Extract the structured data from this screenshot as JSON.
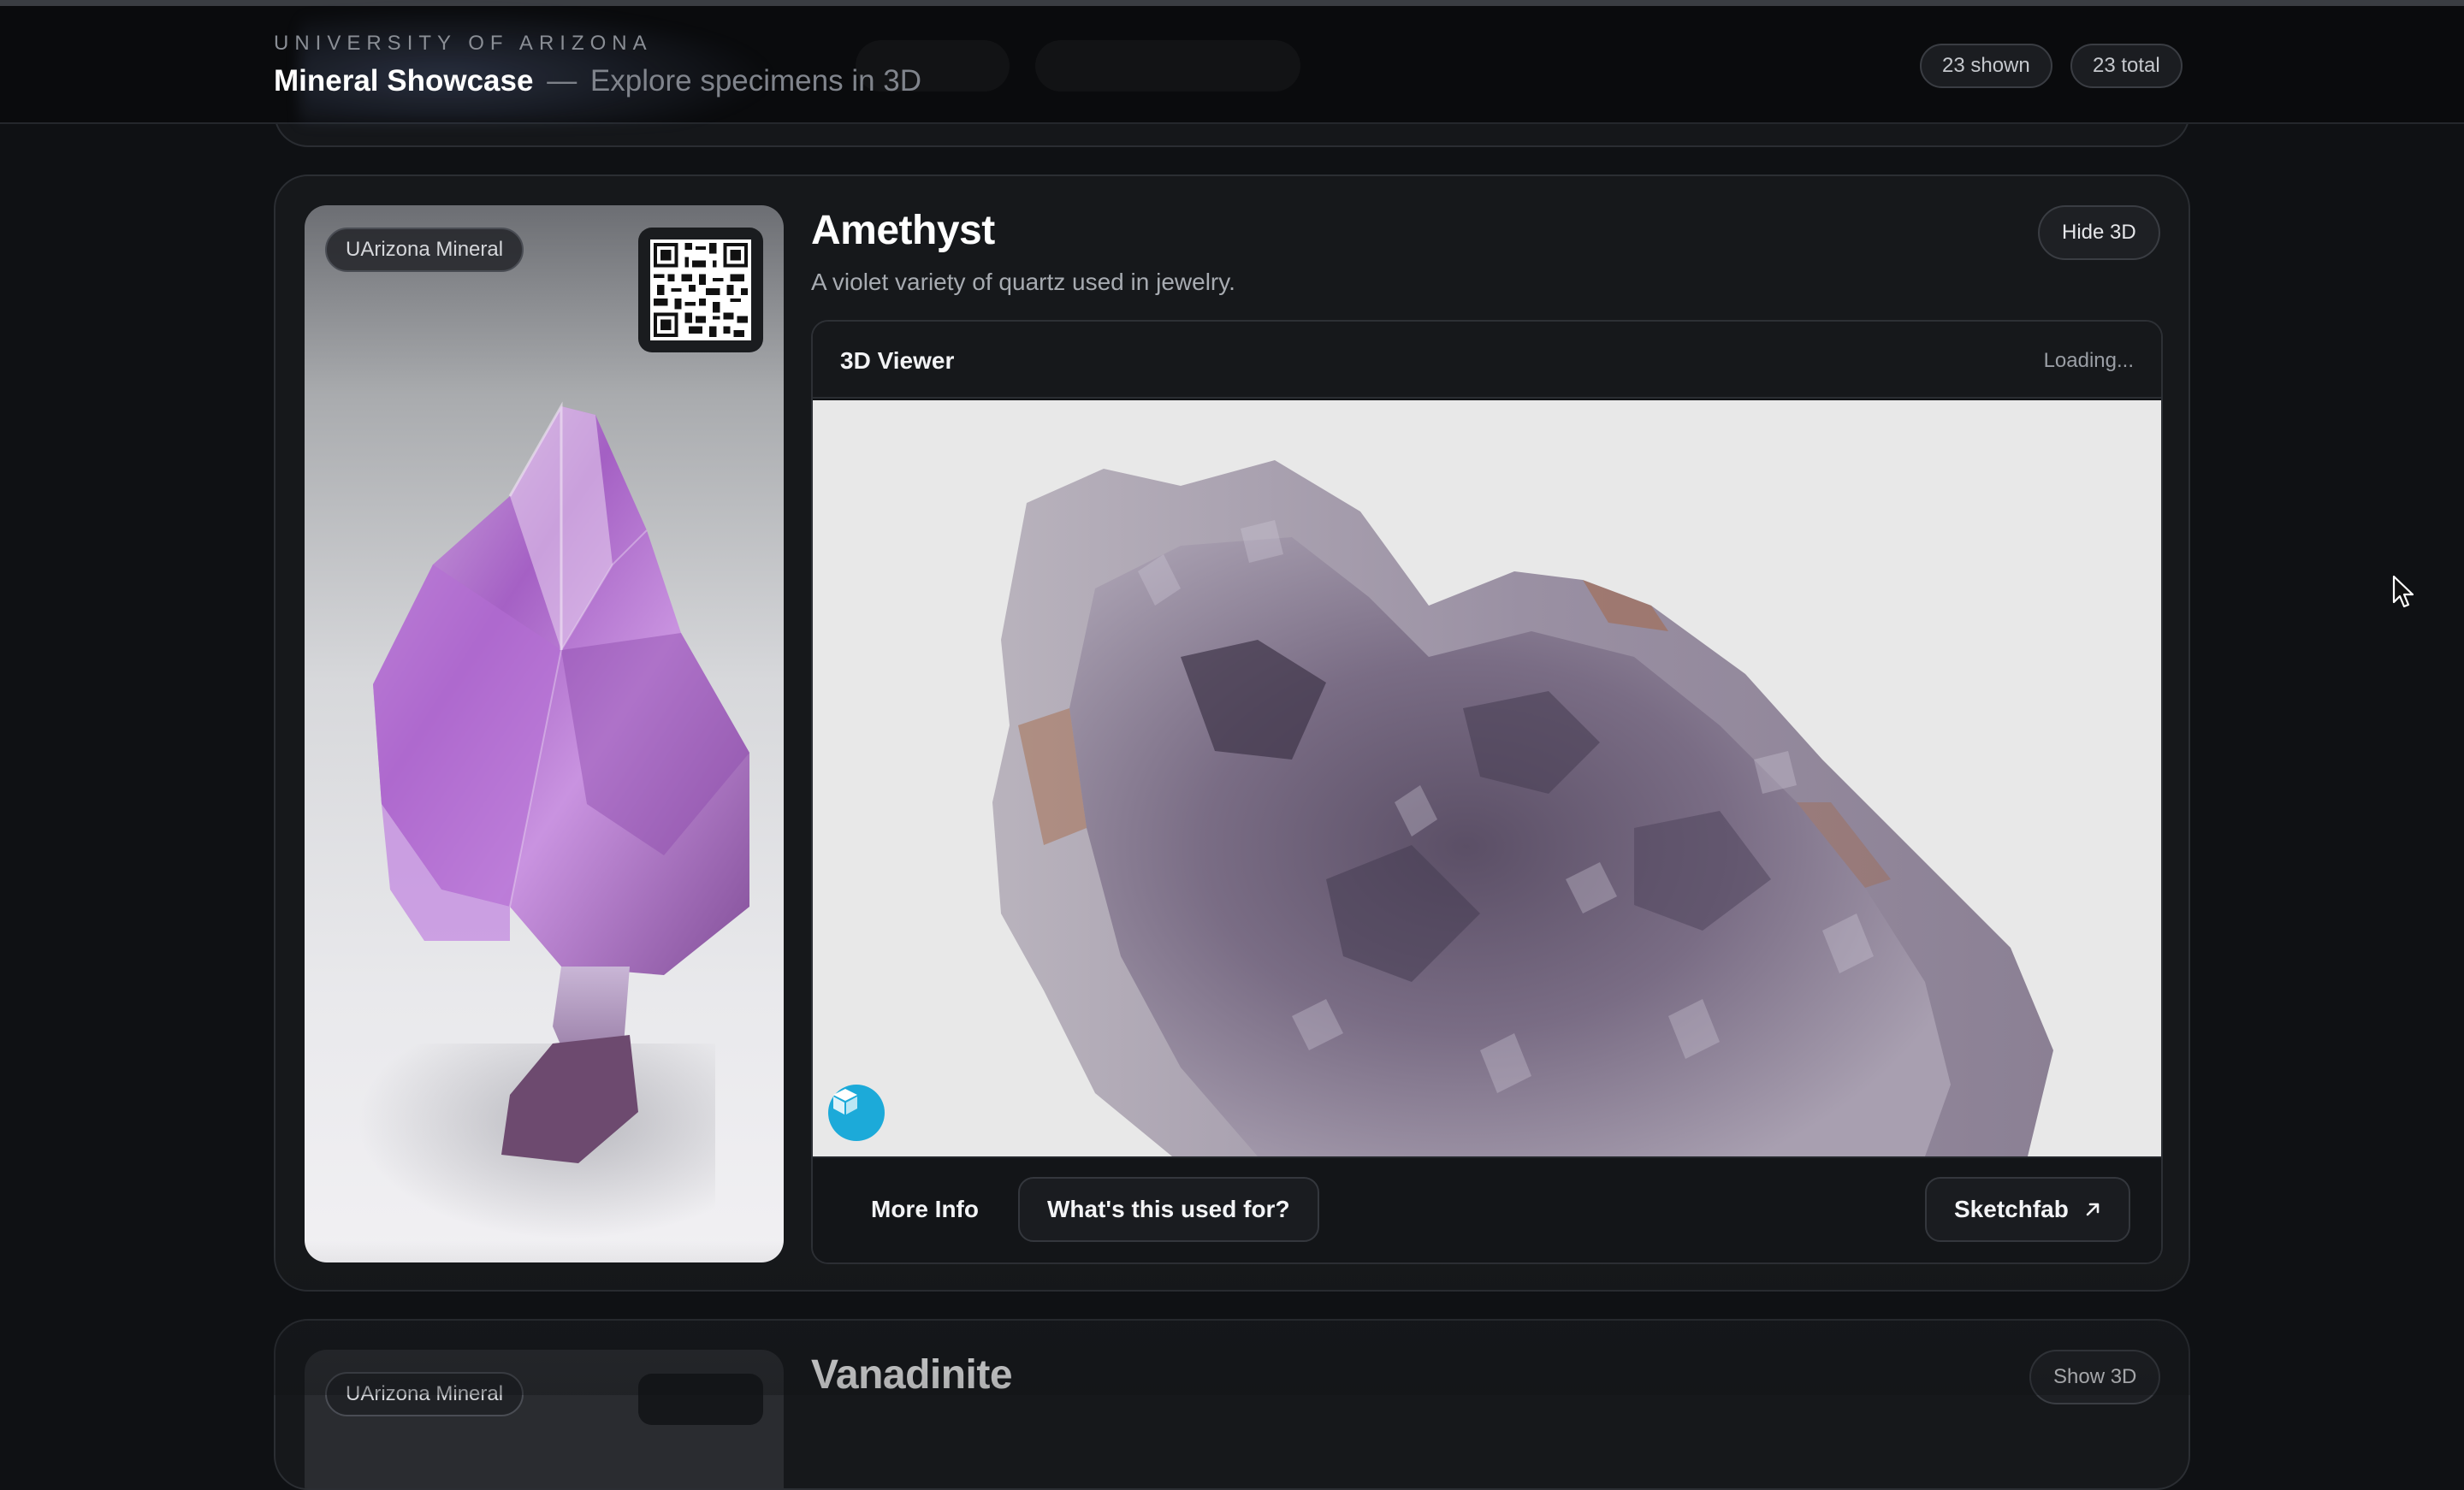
{
  "header": {
    "eyebrow": "UNIVERSITY OF ARIZONA",
    "title": "Mineral Showcase",
    "dash": "—",
    "subtitle": "Explore specimens in 3D",
    "shown_count": "23 shown",
    "total_count": "23 total"
  },
  "featured_card": {
    "source_badge": "UArizona Mineral",
    "name": "Amethyst",
    "description": "A violet variety of quartz used in jewelry.",
    "toggle_label": "Hide 3D",
    "viewer": {
      "title": "3D Viewer",
      "status": "Loading..."
    },
    "actions": {
      "more_info": "More Info",
      "whats_used_for": "What's this used for?",
      "sketchfab": "Sketchfab",
      "sketchfab_icon": "arrow-up-right-icon"
    },
    "icons": [
      "qr-code-icon",
      "sketchfab-logo-icon"
    ]
  },
  "next_card": {
    "source_badge": "UArizona Mineral",
    "name": "Vanadinite",
    "toggle_label": "Show 3D"
  },
  "colors": {
    "background": "#0f1114",
    "card": "#16181b",
    "accent_sketchfab": "#1caad9",
    "amethyst": "#b27ad0"
  }
}
